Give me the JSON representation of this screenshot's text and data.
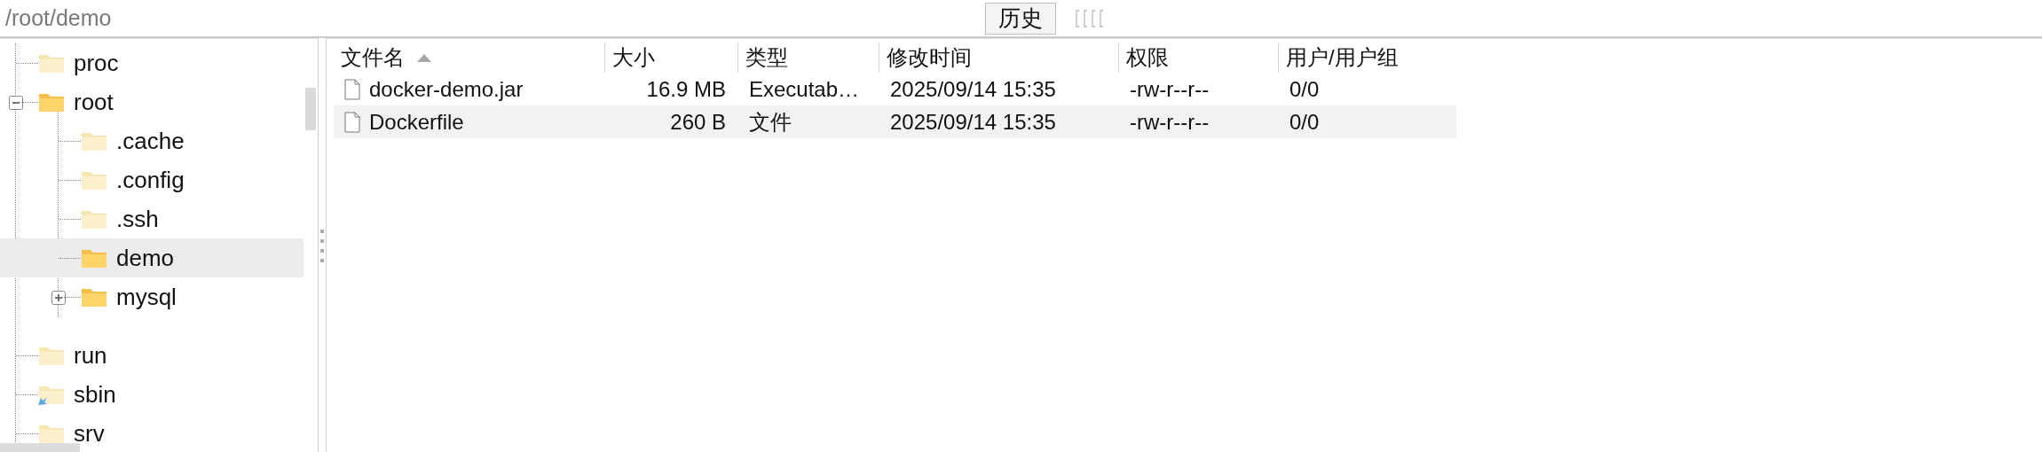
{
  "path_bar": {
    "value": "/root/demo",
    "history_button": "历史"
  },
  "tree": [
    {
      "name": "proc",
      "loaded": false,
      "link": false
    },
    {
      "name": "root",
      "loaded": true,
      "link": false,
      "expanded": true,
      "children": [
        {
          "name": ".cache",
          "loaded": false,
          "link": false
        },
        {
          "name": ".config",
          "loaded": false,
          "link": false
        },
        {
          "name": ".ssh",
          "loaded": false,
          "link": false
        },
        {
          "name": "demo",
          "loaded": true,
          "link": false,
          "selected": true
        },
        {
          "name": "mysql",
          "loaded": true,
          "link": false,
          "expanded": false
        }
      ]
    },
    {
      "name": "run",
      "loaded": false,
      "link": false
    },
    {
      "name": "sbin",
      "loaded": false,
      "link": true
    },
    {
      "name": "srv",
      "loaded": false,
      "link": false
    }
  ],
  "table": {
    "columns": [
      {
        "label": "文件名",
        "sorted": true
      },
      {
        "label": "大小",
        "sorted": false
      },
      {
        "label": "类型",
        "sorted": false
      },
      {
        "label": "修改时间",
        "sorted": false
      },
      {
        "label": "权限",
        "sorted": false
      },
      {
        "label": "用户/用户组",
        "sorted": false
      }
    ],
    "rows": [
      {
        "selected": false,
        "cells": [
          "docker-demo.jar",
          "16.9 MB",
          "Executab…",
          "2025/09/14 15:35",
          "-rw-r--r--",
          "0/0"
        ]
      },
      {
        "selected": true,
        "cells": [
          "Dockerfile",
          "260 B",
          "文件",
          "2025/09/14 15:35",
          "-rw-r--r--",
          "0/0"
        ]
      }
    ]
  }
}
